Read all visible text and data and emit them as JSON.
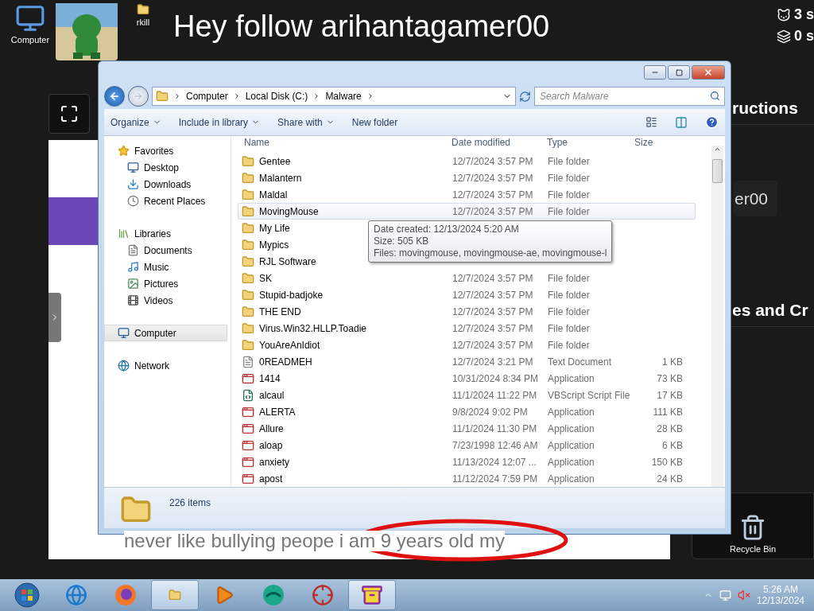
{
  "desktop_icons": [
    {
      "label": "Computer"
    },
    {
      "label": "rkill"
    }
  ],
  "page": {
    "title": "Hey follow arihantagamer00",
    "stats": [
      "3 s",
      "0 s"
    ],
    "side_headings": [
      "ructions",
      "es and Cr"
    ],
    "side_badge": "er00",
    "stage_caption": "never like bullying peope i am 9 years old my"
  },
  "recycle_bin": {
    "label": "Recycle Bin"
  },
  "explorer": {
    "breadcrumb": [
      "Computer",
      "Local Disk (C:)",
      "Malware"
    ],
    "search": {
      "placeholder": "Search Malware"
    },
    "toolbar": [
      {
        "label": "Organize",
        "menu": true
      },
      {
        "label": "Include in library",
        "menu": true
      },
      {
        "label": "Share with",
        "menu": true
      },
      {
        "label": "New folder",
        "menu": false
      }
    ],
    "nav": [
      {
        "label": "Favorites",
        "selected": false,
        "children": [
          {
            "label": "Desktop",
            "selected": false
          },
          {
            "label": "Downloads",
            "selected": false
          },
          {
            "label": "Recent Places",
            "selected": false
          }
        ]
      },
      {
        "label": "Libraries",
        "selected": false,
        "children": [
          {
            "label": "Documents",
            "selected": false
          },
          {
            "label": "Music",
            "selected": false
          },
          {
            "label": "Pictures",
            "selected": false
          },
          {
            "label": "Videos",
            "selected": false
          }
        ]
      },
      {
        "label": "Computer",
        "selected": true
      },
      {
        "label": "Network",
        "selected": false
      }
    ],
    "columns": [
      "Name",
      "Date modified",
      "Type",
      "Size"
    ],
    "rows": [
      {
        "kind": "folder",
        "name": "Gentee",
        "date": "12/7/2024 3:57 PM",
        "type": "File folder",
        "hovered": false
      },
      {
        "kind": "folder",
        "name": "Malantern",
        "date": "12/7/2024 3:57 PM",
        "type": "File folder",
        "hovered": false
      },
      {
        "kind": "folder",
        "name": "Maldal",
        "date": "12/7/2024 3:57 PM",
        "type": "File folder",
        "hovered": false
      },
      {
        "kind": "folder",
        "name": "MovingMouse",
        "date": "12/7/2024 3:57 PM",
        "type": "File folder",
        "hovered": true
      },
      {
        "kind": "folder",
        "name": "My Life",
        "hovered": false
      },
      {
        "kind": "folder",
        "name": "Mypics",
        "hovered": false
      },
      {
        "kind": "folder",
        "name": "RJL Software",
        "hovered": false
      },
      {
        "kind": "folder",
        "name": "SK",
        "date": "12/7/2024 3:57 PM",
        "type": "File folder",
        "hovered": false
      },
      {
        "kind": "folder",
        "name": "Stupid-badjoke",
        "date": "12/7/2024 3:57 PM",
        "type": "File folder",
        "hovered": false
      },
      {
        "kind": "folder",
        "name": "THE END",
        "date": "12/7/2024 3:57 PM",
        "type": "File folder",
        "hovered": false
      },
      {
        "kind": "folder",
        "name": "Virus.Win32.HLLP.Toadie",
        "date": "12/7/2024 3:57 PM",
        "type": "File folder",
        "hovered": false
      },
      {
        "kind": "folder",
        "name": "YouAreAnIdiot",
        "date": "12/7/2024 3:57 PM",
        "type": "File folder",
        "hovered": false
      },
      {
        "kind": "text",
        "name": "0READMEH",
        "date": "12/7/2024 3:21 PM",
        "type": "Text Document",
        "size": "1 KB",
        "hovered": false
      },
      {
        "kind": "app",
        "name": "1414",
        "date": "10/31/2024 8:34 PM",
        "type": "Application",
        "size": "73 KB",
        "hovered": false
      },
      {
        "kind": "script",
        "name": "alcaul",
        "date": "11/1/2024 11:22 PM",
        "type": "VBScript Script File",
        "size": "17 KB",
        "hovered": false
      },
      {
        "kind": "app",
        "name": "ALERTA",
        "date": "9/8/2024 9:02 PM",
        "type": "Application",
        "size": "111 KB",
        "hovered": false
      },
      {
        "kind": "app",
        "name": "Allure",
        "date": "11/1/2024 11:30 PM",
        "type": "Application",
        "size": "28 KB",
        "hovered": false
      },
      {
        "kind": "app",
        "name": "aloap",
        "date": "7/23/1998 12:46 AM",
        "type": "Application",
        "size": "6 KB",
        "hovered": false
      },
      {
        "kind": "app",
        "name": "anxiety",
        "date": "11/13/2024 12:07 ...",
        "type": "Application",
        "size": "150 KB",
        "hovered": false
      },
      {
        "kind": "app",
        "name": "apost",
        "date": "11/12/2024 7:59 PM",
        "type": "Application",
        "size": "24 KB",
        "hovered": false
      }
    ],
    "tooltip": [
      "Date created: 12/13/2024 5:20 AM",
      "Size: 505 KB",
      "Files: movingmouse, movingmouse-ae, movingmouse-l"
    ],
    "status": "226 items"
  },
  "taskbar": {
    "items": [
      {
        "selected": false
      },
      {
        "selected": false
      },
      {
        "selected": true
      },
      {
        "selected": false
      },
      {
        "selected": false
      },
      {
        "selected": false
      },
      {
        "selected": true
      }
    ],
    "clock": {
      "time": "5:26 AM",
      "date": "12/13/2024"
    }
  }
}
